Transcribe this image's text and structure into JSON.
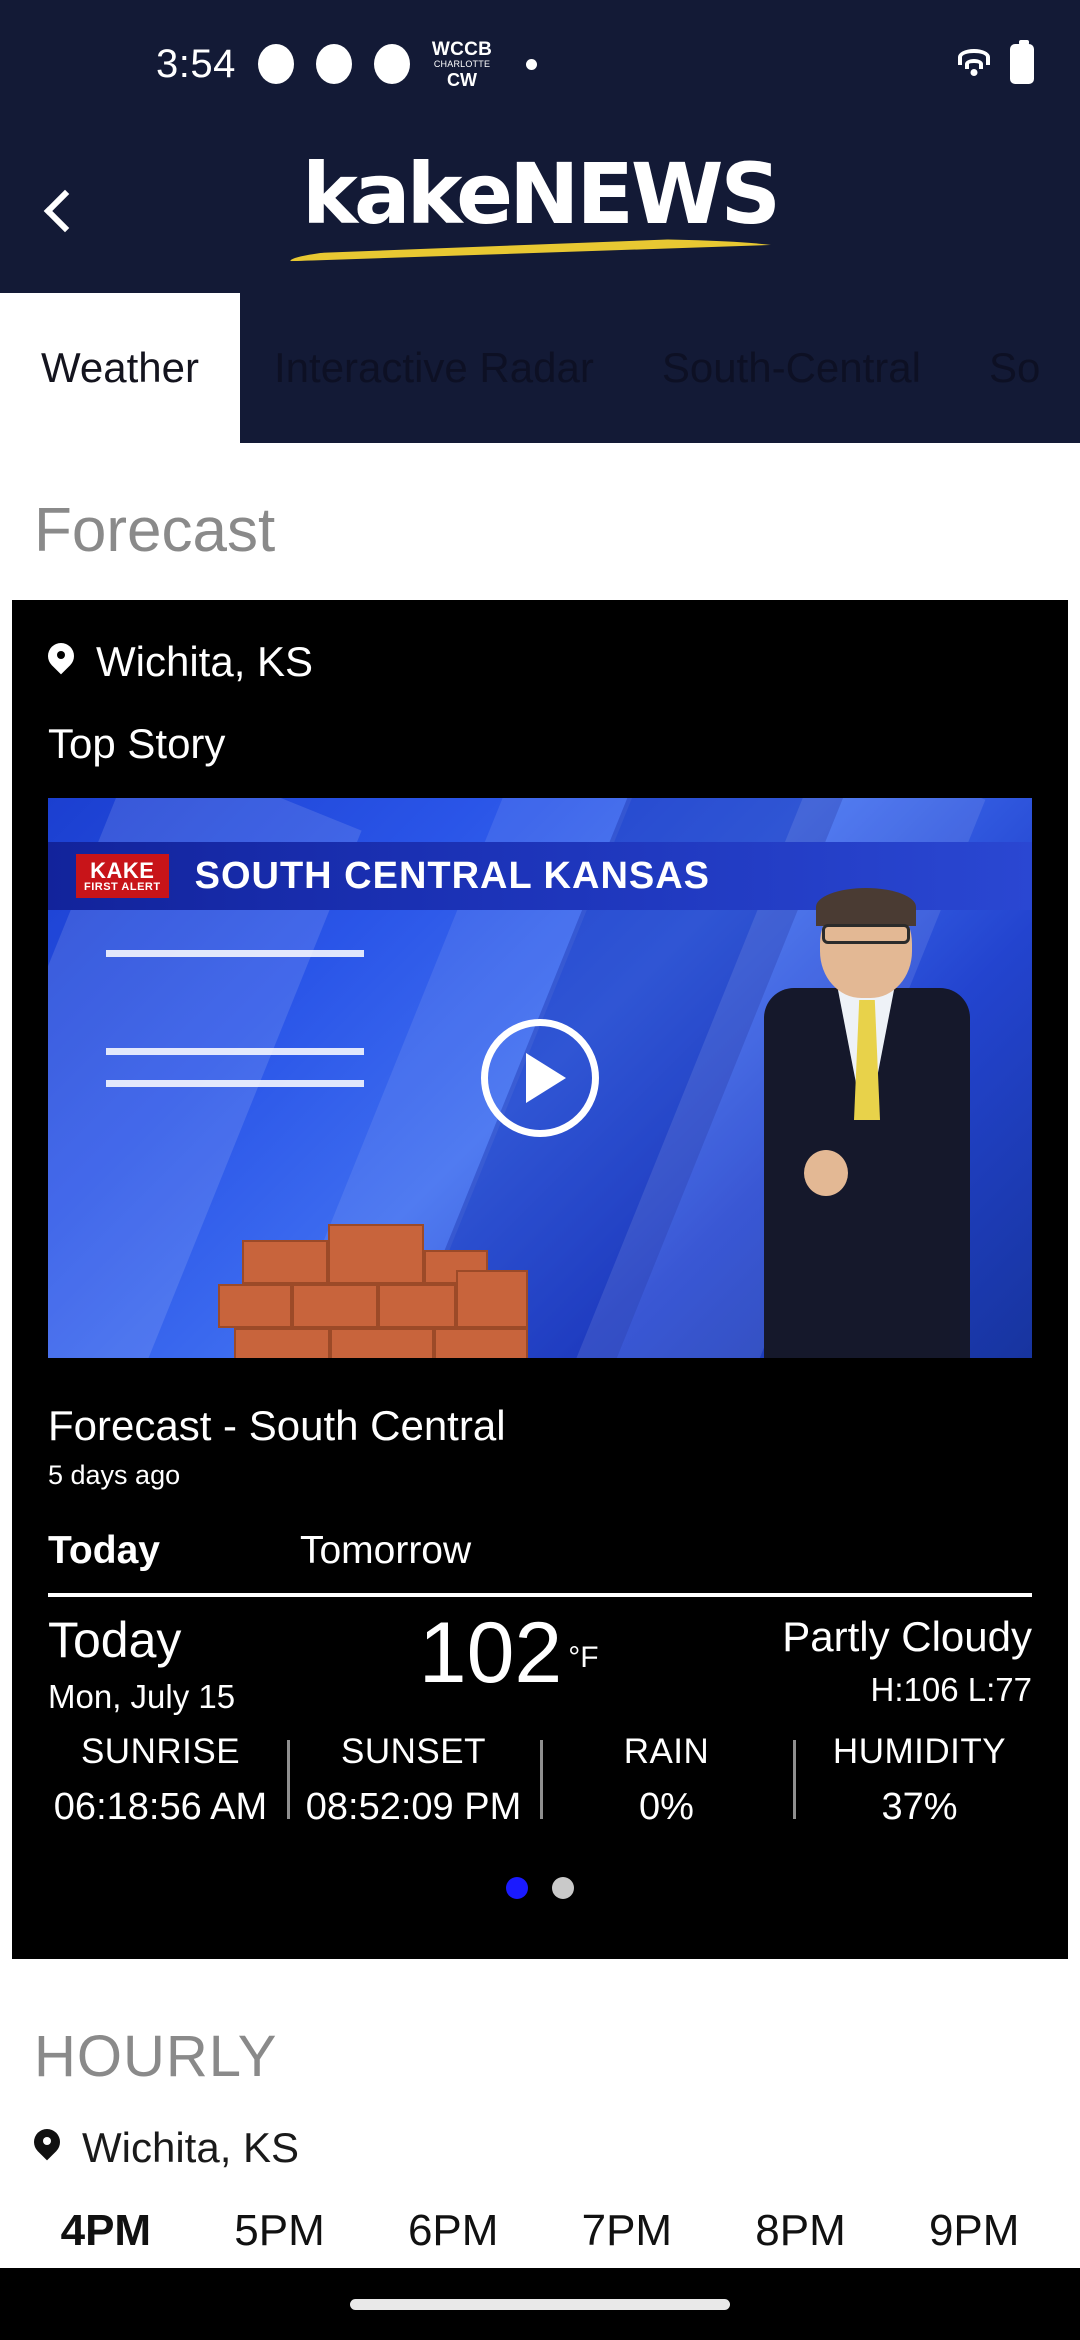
{
  "status_bar": {
    "time": "3:54",
    "notification_dots": 3,
    "app_badge": {
      "line1": "WCCB",
      "line2": "CHARLOTTE",
      "line3": "CW"
    },
    "wifi_icon": "wifi-icon",
    "battery_icon": "battery-charging-icon"
  },
  "header": {
    "back_icon": "back-chevron-icon",
    "logo_bold": "kake",
    "logo_light": "NEWS"
  },
  "tabs": [
    {
      "label": "Weather",
      "active": true
    },
    {
      "label": "Interactive Radar",
      "active": false
    },
    {
      "label": "South-Central",
      "active": false
    },
    {
      "label": "So",
      "active": false
    }
  ],
  "forecast": {
    "section_title": "Forecast",
    "location": "Wichita, KS",
    "location_icon": "location-pin-icon",
    "top_story_label": "Top Story",
    "video": {
      "banner_text": "SOUTH CENTRAL KANSAS",
      "station_logo_line1": "KAKE",
      "station_logo_line2": "FIRST ALERT",
      "play_icon": "play-button-icon"
    },
    "video_title": "Forecast - South Central",
    "video_timestamp": "5 days ago",
    "day_tabs": [
      {
        "label": "Today",
        "active": true
      },
      {
        "label": "Tomorrow",
        "active": false
      }
    ],
    "current": {
      "day": "Today",
      "date": "Mon, July 15",
      "temperature": "102",
      "unit": "°F",
      "condition": "Partly Cloudy",
      "high_low": "H:106 L:77"
    },
    "metrics": [
      {
        "label": "SUNRISE",
        "value": "06:18:56 AM"
      },
      {
        "label": "SUNSET",
        "value": "08:52:09 PM"
      },
      {
        "label": "RAIN",
        "value": "0%"
      },
      {
        "label": "HUMIDITY",
        "value": "37%"
      }
    ],
    "pager": {
      "count": 2,
      "active_index": 0,
      "active_color": "#1a1aff",
      "inactive_color": "#c9c9c9"
    }
  },
  "hourly": {
    "section_title": "HOURLY",
    "location": "Wichita, KS",
    "location_icon": "location-pin-icon",
    "hours": [
      {
        "label": "4PM",
        "active": true
      },
      {
        "label": "5PM",
        "active": false
      },
      {
        "label": "6PM",
        "active": false
      },
      {
        "label": "7PM",
        "active": false
      },
      {
        "label": "8PM",
        "active": false
      },
      {
        "label": "9PM",
        "active": false
      }
    ]
  },
  "theme": {
    "header_bg": "#131a36",
    "card_bg": "#000000",
    "accent_yellow": "#e8c832",
    "page_bg": "#ffffff"
  }
}
